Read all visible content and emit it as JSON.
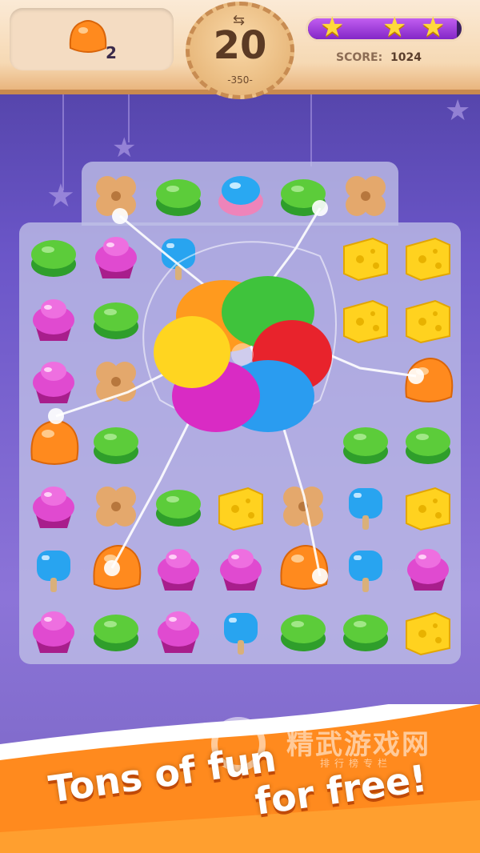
{
  "hud": {
    "goal_count": "2",
    "moves_left": "20",
    "moves_target": "-350-",
    "score_label": "SCORE:",
    "score_value": "1024",
    "progress_fraction": 0.97,
    "stars_earned": 3,
    "icons": {
      "goal": "orange-jelly-icon",
      "moves": "swap-arrows-icon",
      "star": "star-icon"
    }
  },
  "board": {
    "special": "rainbow-flower-bomb",
    "rows": [
      [
        "cookie",
        "gummy-green",
        "cupcake-blue-jelly",
        "gummy-green",
        "cookie",
        "",
        ""
      ],
      [
        "gummy-green",
        "cupcake",
        "popsicle-blue",
        "",
        "",
        "cheese",
        "cheese"
      ],
      [
        "cupcake",
        "gummy-green",
        "",
        "",
        "",
        "cheese",
        "cheese"
      ],
      [
        "cupcake",
        "cookie",
        "",
        "",
        "",
        "",
        "jelly-orange"
      ],
      [
        "jelly-orange",
        "gummy-green",
        "",
        "",
        "",
        "gummy-green",
        "gummy-green"
      ],
      [
        "cupcake",
        "cookie",
        "gummy-green",
        "cheese",
        "cookie",
        "popsicle-blue",
        "cheese"
      ],
      [
        "popsicle-blue",
        "jelly-orange",
        "cupcake",
        "cupcake",
        "jelly-orange",
        "popsicle-blue",
        "cupcake"
      ],
      [
        "cupcake",
        "gummy-green",
        "cupcake",
        "popsicle-blue",
        "gummy-green",
        "gummy-green",
        "cheese"
      ]
    ]
  },
  "banner": {
    "line1": "Tons of fun",
    "line2": "for free!",
    "watermark_main": "精武游戏网",
    "watermark_sub": "排行榜专栏"
  },
  "colors": {
    "accent_orange": "#ff8a1e",
    "banner_bg": "#ffffff",
    "purple_bg": "#6b56c8"
  }
}
